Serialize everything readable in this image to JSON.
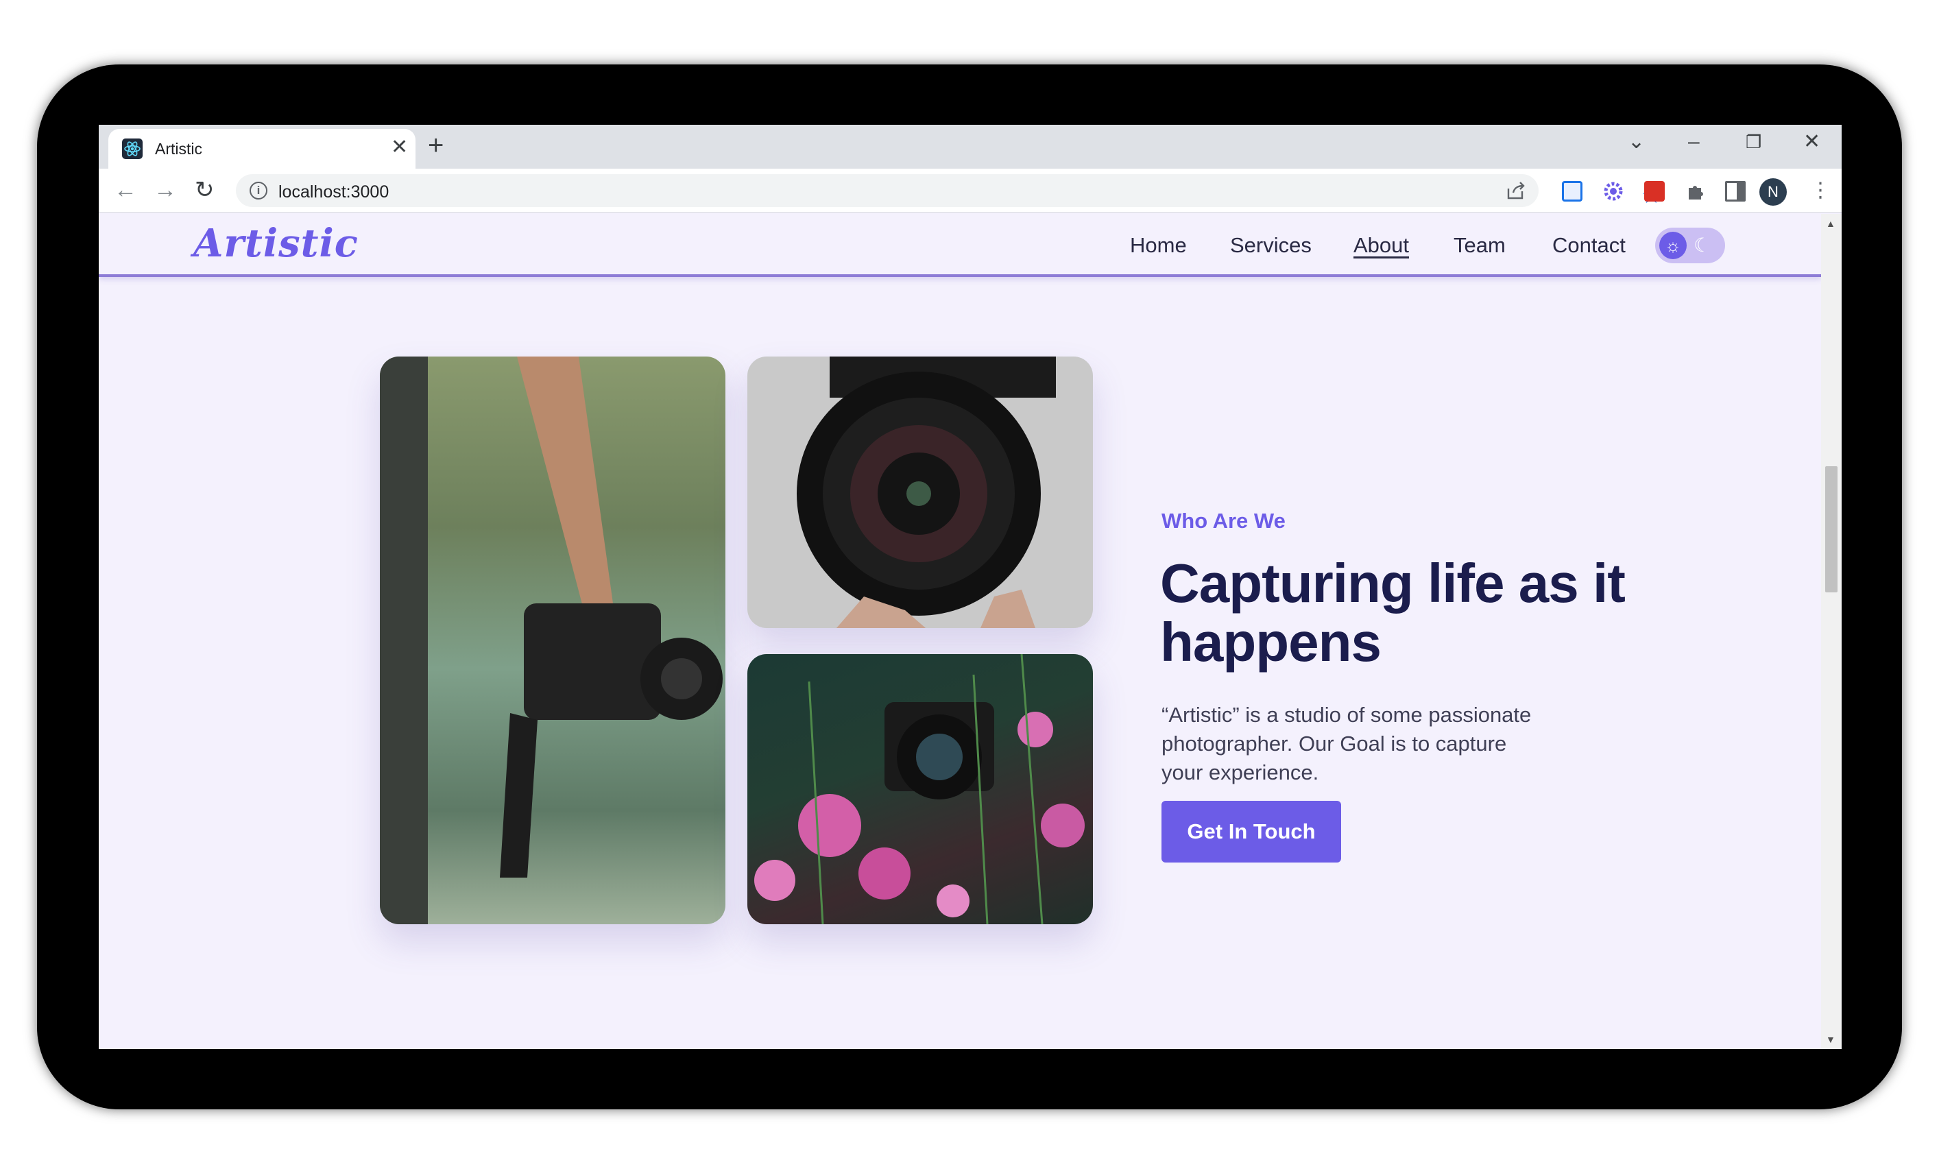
{
  "browser": {
    "tab_title": "Artistic",
    "new_tab": "+",
    "tab_close": "✕",
    "url": "localhost:3000",
    "profile_initial": "N",
    "window_controls": {
      "dropdown": "⌄",
      "minimize": "–",
      "restore": "❐",
      "close": "✕"
    },
    "nav": {
      "back": "←",
      "forward": "→",
      "reload": "↻"
    }
  },
  "site": {
    "logo": "Artistic",
    "nav": {
      "home": "Home",
      "services": "Services",
      "about": "About",
      "team": "Team",
      "contact": "Contact"
    },
    "hero": {
      "eyebrow": "Who Are We",
      "headline": "Capturing life as it happens",
      "description": "“Artistic” is a studio of some passionate photographer. Our Goal is to capture your experience.",
      "cta": "Get In Touch"
    }
  },
  "colors": {
    "accent": "#6c5ce7",
    "heading": "#1b1d4d",
    "background": "#f4f1fd"
  }
}
